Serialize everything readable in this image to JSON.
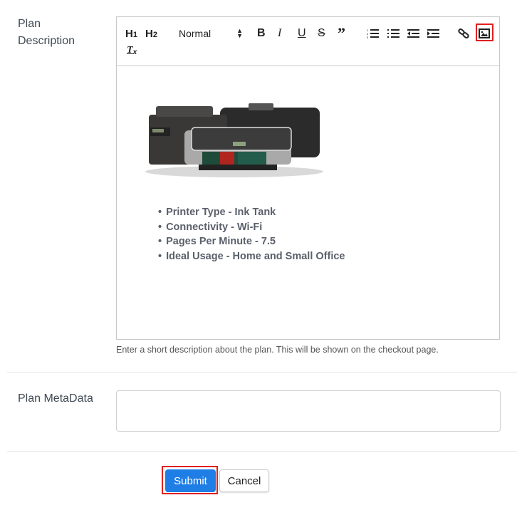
{
  "plan_description": {
    "label": "Plan\nDescription",
    "label_line1": "Plan",
    "label_line2": "Description",
    "toolbar": {
      "h1": "H1",
      "h2": "H2",
      "format_select": "Normal",
      "buttons": [
        "bold",
        "italic",
        "underline",
        "strike",
        "blockquote",
        "ordered-list",
        "bullet-list",
        "outdent",
        "indent",
        "link",
        "image",
        "clean"
      ]
    },
    "content": {
      "image_alt": "Printer product image",
      "features": [
        "Printer Type - Ink Tank",
        "Connectivity - Wi-Fi",
        "Pages Per Minute - 7.5",
        "Ideal Usage - Home and Small Office"
      ]
    },
    "help_text": "Enter a short description about the plan. This will be shown on the checkout page."
  },
  "plan_metadata": {
    "label": "Plan MetaData",
    "value": ""
  },
  "actions": {
    "submit_label": "Submit",
    "cancel_label": "Cancel"
  },
  "colors": {
    "primary": "#1e7ee6",
    "highlight": "#e02020"
  }
}
